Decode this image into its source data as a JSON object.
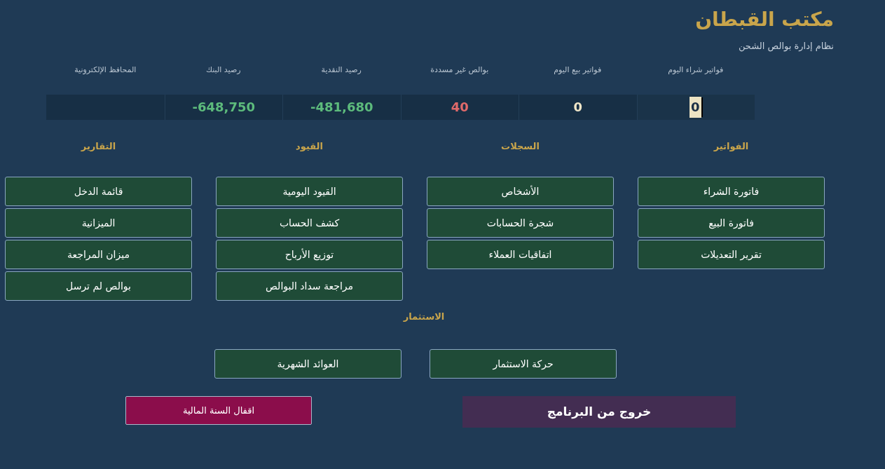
{
  "header": {
    "title": "مكتب القبطان",
    "subtitle": "نظام إدارة بوالص الشحن"
  },
  "stats": [
    {
      "label": "فواتير شراء اليوم",
      "value": "0",
      "color": "#ece3c3",
      "focused": true
    },
    {
      "label": "فواتير بيع اليوم",
      "value": "0",
      "color": "#efe6c8",
      "focused": false
    },
    {
      "label": "بوالص غير مسددة",
      "value": "40",
      "color": "#e06a6a",
      "focused": false
    },
    {
      "label": "رصيد النقدية",
      "value": "-481,680",
      "color": "#5dbb7c",
      "focused": false
    },
    {
      "label": "رصيد البنك",
      "value": "-648,750",
      "color": "#5dbb7c",
      "focused": false
    },
    {
      "label": "المحافظ الإلكترونية",
      "focused": false
    }
  ],
  "sections": [
    {
      "title": "الفواتير",
      "buttons": [
        "فاتورة الشراء",
        "فاتورة البيع",
        "تقرير التعديلات"
      ]
    },
    {
      "title": "السجلات",
      "buttons": [
        "الأشخاص",
        "شجرة الحسابات",
        "اتفاقيات العملاء"
      ]
    },
    {
      "title": "القيود",
      "buttons": [
        "القيود اليومية",
        "كشف الحساب",
        "توزيع الأرباح",
        "مراجعة سداد البوالص"
      ]
    },
    {
      "title": "التقارير",
      "buttons": [
        "قائمة الدخل",
        "الميزانية",
        "ميزان المراجعة",
        "بوالص لم ترسل"
      ]
    }
  ],
  "investment": {
    "title": "الاستثمار",
    "buttons": [
      "حركة الاستثمار",
      "العوائد الشهرية"
    ]
  },
  "actions": [
    {
      "kind": "exit",
      "label": "خروج من البرنامج"
    },
    {
      "kind": "close_year",
      "label": "اقفال السنة المالية"
    }
  ]
}
